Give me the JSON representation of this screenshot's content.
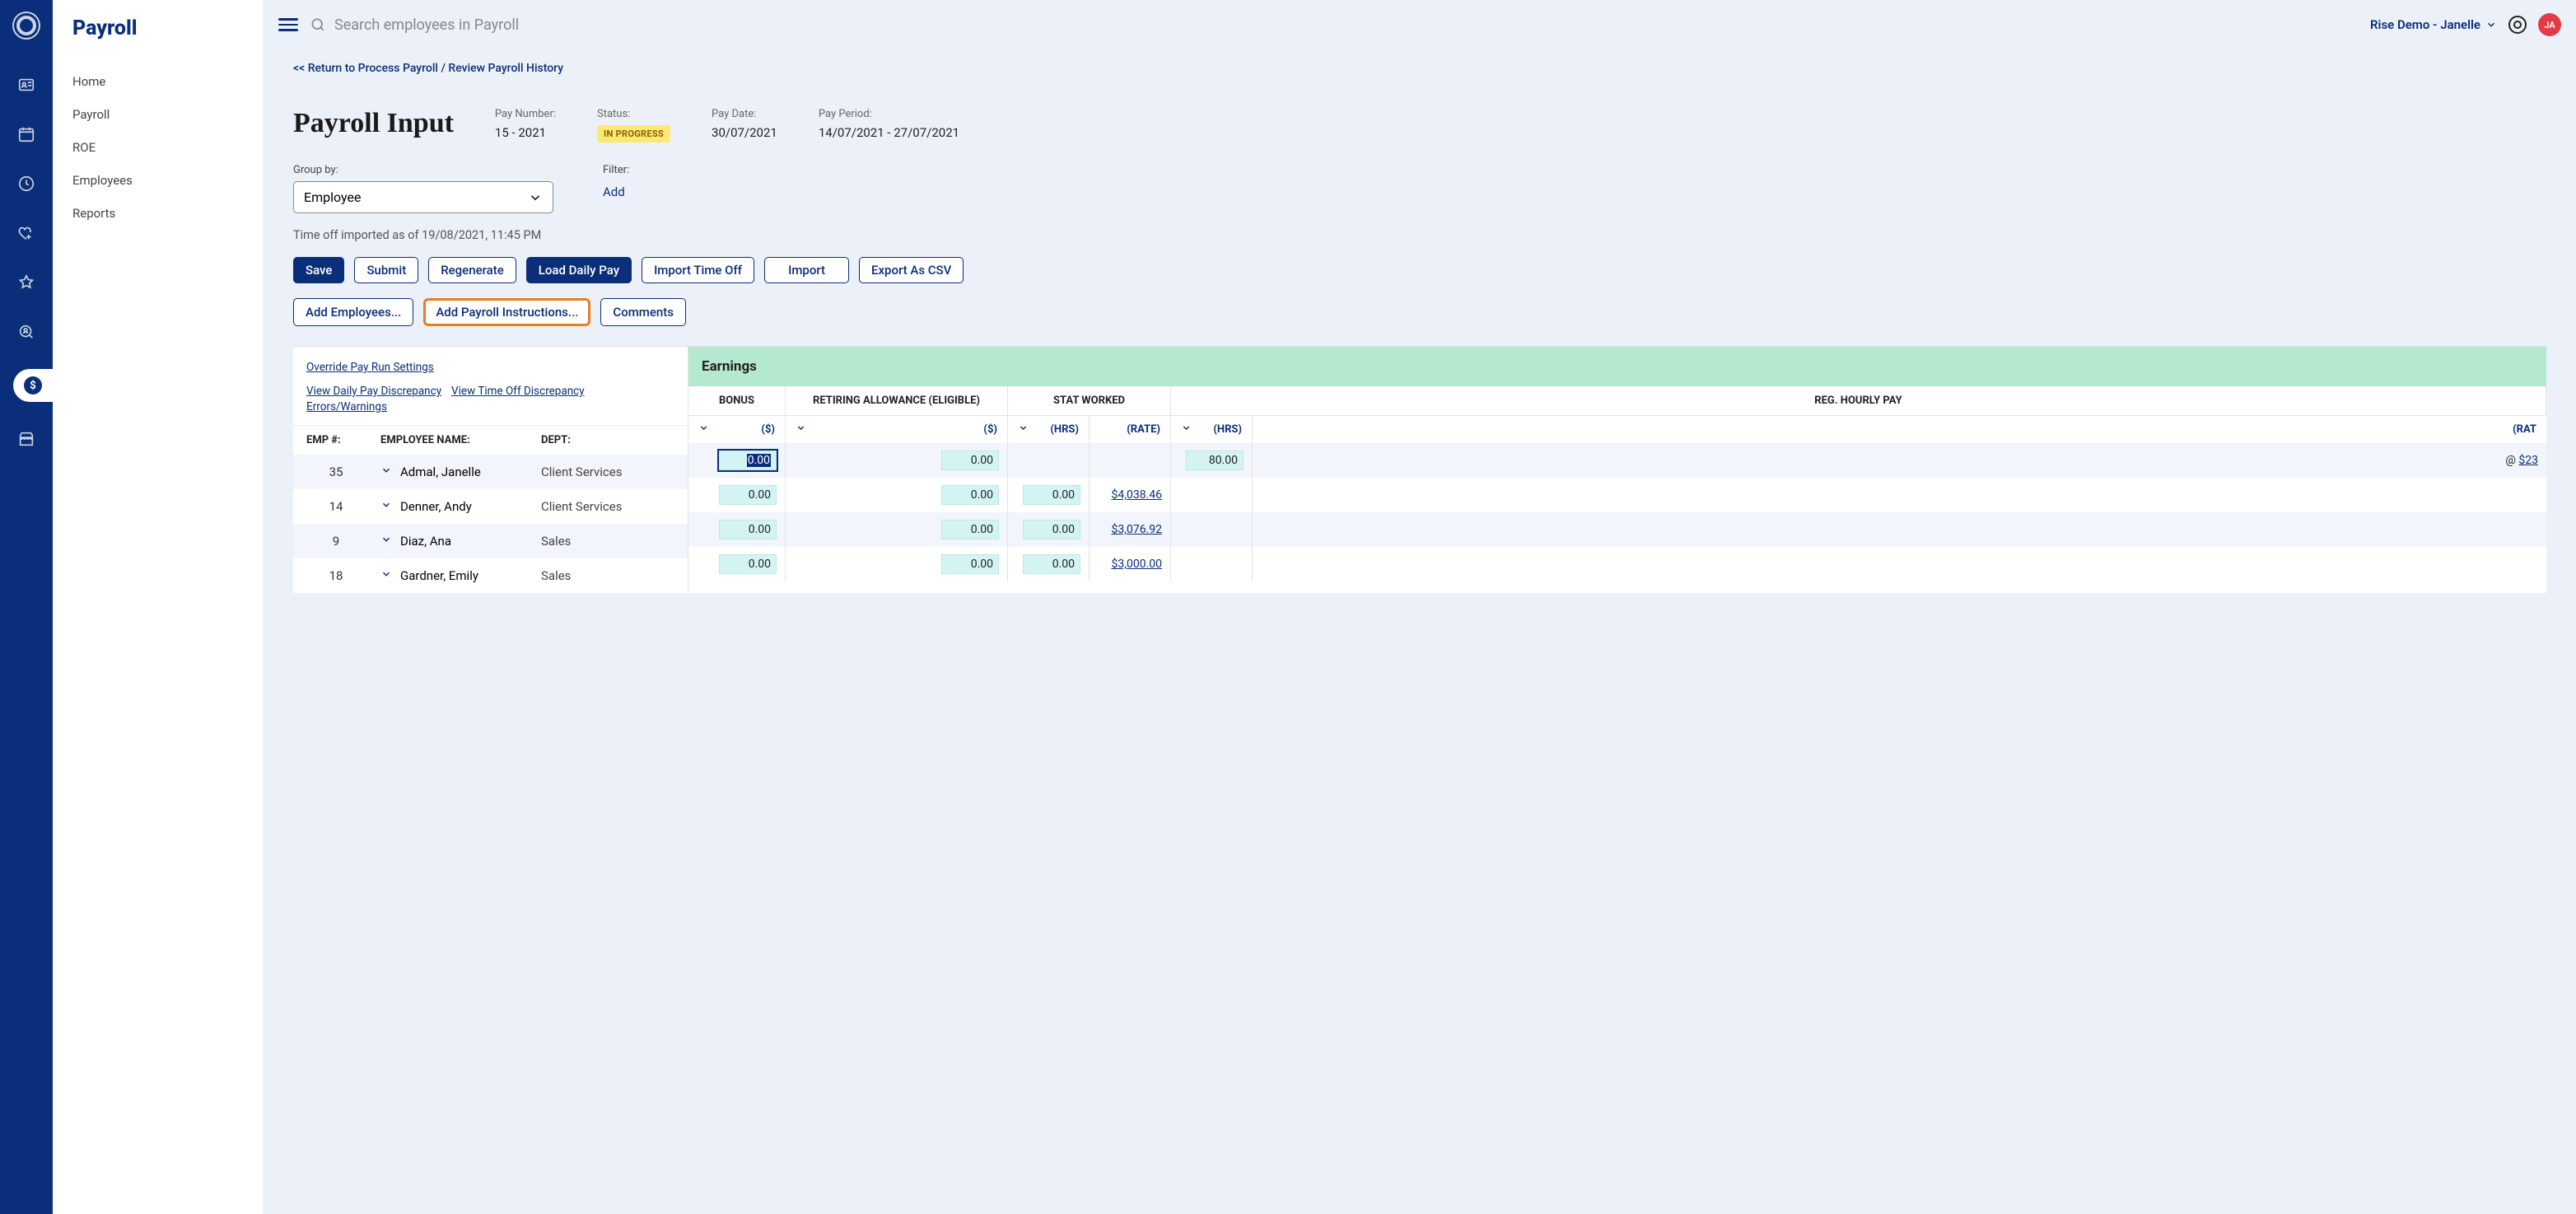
{
  "app": {
    "section_title": "Payroll"
  },
  "sidebar": {
    "items": [
      "Home",
      "Payroll",
      "ROE",
      "Employees",
      "Reports"
    ]
  },
  "topbar": {
    "search_placeholder": "Search employees in Payroll",
    "company": "Rise Demo - Janelle",
    "avatar_initials": "JA"
  },
  "breadcrumb": "<< Return to Process Payroll / Review Payroll History",
  "page_title": "Payroll Input",
  "summary": {
    "pay_number_label": "Pay Number:",
    "pay_number": "15 - 2021",
    "status_label": "Status:",
    "status": "IN PROGRESS",
    "pay_date_label": "Pay Date:",
    "pay_date": "30/07/2021",
    "pay_period_label": "Pay Period:",
    "pay_period": "14/07/2021 - 27/07/2021"
  },
  "group_by": {
    "label": "Group by:",
    "value": "Employee"
  },
  "filter": {
    "label": "Filter:",
    "add": "Add"
  },
  "import_note": "Time off imported as of 19/08/2021, 11:45 PM",
  "actions": {
    "save": "Save",
    "submit": "Submit",
    "regenerate": "Regenerate",
    "load_daily": "Load Daily Pay",
    "import_time": "Import Time Off",
    "import": "Import",
    "export": "Export As CSV",
    "add_emp": "Add Employees...",
    "add_instr": "Add Payroll Instructions...",
    "comments": "Comments"
  },
  "left_links": {
    "override": "Override Pay Run Settings",
    "daily_disc": "View Daily Pay Discrepancy",
    "timeoff_disc": "View Time Off Discrepancy",
    "errors": "Errors/Warnings"
  },
  "headers": {
    "emp": "EMP #:",
    "name": "EMPLOYEE NAME:",
    "dept": "DEPT:"
  },
  "earnings": {
    "title": "Earnings",
    "bonus": "BONUS",
    "retire": "RETIRING ALLOWANCE (ELIGIBLE)",
    "stat": "STAT WORKED",
    "reg": "REG. HOURLY PAY",
    "sub_dollar": "($)",
    "sub_hrs": "(HRS)",
    "sub_rate": "(RATE)",
    "sub_rat_cut": "(RAT"
  },
  "rows": [
    {
      "emp": "35",
      "name": "Admal, Janelle",
      "dept": "Client Services",
      "bonus": "0.00",
      "retire": "0.00",
      "stat_hrs": "",
      "stat_rate": "",
      "reg_hrs": "80.00",
      "reg_rate": "$23",
      "focused": true,
      "at": "@"
    },
    {
      "emp": "14",
      "name": "Denner, Andy",
      "dept": "Client Services",
      "bonus": "0.00",
      "retire": "0.00",
      "stat_hrs": "0.00",
      "stat_rate": "$4,038.46",
      "reg_hrs": "",
      "reg_rate": ""
    },
    {
      "emp": "9",
      "name": "Diaz, Ana",
      "dept": "Sales",
      "bonus": "0.00",
      "retire": "0.00",
      "stat_hrs": "0.00",
      "stat_rate": "$3,076.92",
      "reg_hrs": "",
      "reg_rate": ""
    },
    {
      "emp": "18",
      "name": "Gardner, Emily",
      "dept": "Sales",
      "bonus": "0.00",
      "retire": "0.00",
      "stat_hrs": "0.00",
      "stat_rate": "$3,000.00",
      "reg_hrs": "",
      "reg_rate": ""
    }
  ]
}
